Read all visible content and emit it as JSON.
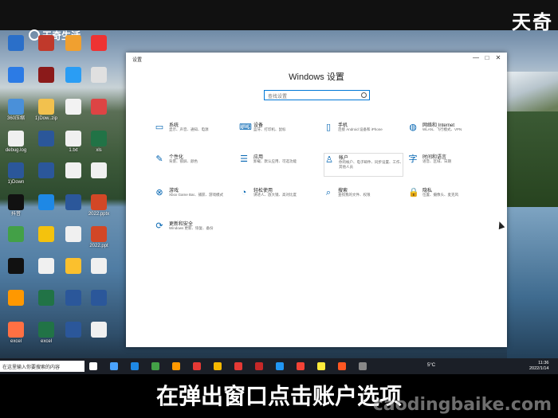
{
  "overlay": {
    "top_left_logo": "天奇生活",
    "top_right_brand": "天奇",
    "subtitle": "在弹出窗口点击账户选项",
    "watermark": "caodingbaike.com"
  },
  "desktop_icons": [
    {
      "label": "",
      "color": "#2a6fc9"
    },
    {
      "label": "",
      "color": "#c0392b"
    },
    {
      "label": "",
      "color": "#f0a030"
    },
    {
      "label": "",
      "color": "#e33"
    },
    {
      "label": "",
      "color": "#2c7be5"
    },
    {
      "label": "",
      "color": "#8b1a1a"
    },
    {
      "label": "",
      "color": "#2a9df4"
    },
    {
      "label": "",
      "color": "#e0e0e0"
    },
    {
      "label": "360压缩",
      "color": "#4a90d9"
    },
    {
      "label": "1)Dow..zip",
      "color": "#f2c14e"
    },
    {
      "label": "",
      "color": "#f2f2f2"
    },
    {
      "label": "",
      "color": "#d44"
    },
    {
      "label": "debug.log",
      "color": "#f0f0f0"
    },
    {
      "label": "",
      "color": "#2b579a"
    },
    {
      "label": "1.txt",
      "color": "#f0f0f0"
    },
    {
      "label": "xls",
      "color": "#217346"
    },
    {
      "label": "1)Down",
      "color": "#2b579a"
    },
    {
      "label": "",
      "color": "#2b579a"
    },
    {
      "label": "",
      "color": "#f0f0f0"
    },
    {
      "label": "",
      "color": "#f0f0f0"
    },
    {
      "label": "抖音",
      "color": "#111"
    },
    {
      "label": "",
      "color": "#1e88e5"
    },
    {
      "label": "",
      "color": "#2b579a"
    },
    {
      "label": "2022.pptx",
      "color": "#d24726"
    },
    {
      "label": "",
      "color": "#43a047"
    },
    {
      "label": "",
      "color": "#f4c20d"
    },
    {
      "label": "",
      "color": "#f0f0f0"
    },
    {
      "label": "2022.ppt",
      "color": "#d24726"
    },
    {
      "label": "",
      "color": "#111"
    },
    {
      "label": "",
      "color": "#f0f0f0"
    },
    {
      "label": "",
      "color": "#fbc02d"
    },
    {
      "label": "",
      "color": "#f0f0f0"
    },
    {
      "label": "",
      "color": "#ff9800"
    },
    {
      "label": "",
      "color": "#217346"
    },
    {
      "label": "",
      "color": "#2b579a"
    },
    {
      "label": "",
      "color": "#2b579a"
    },
    {
      "label": "excel",
      "color": "#ff7043"
    },
    {
      "label": "excel",
      "color": "#217346"
    },
    {
      "label": "",
      "color": "#2b579a"
    },
    {
      "label": "",
      "color": "#f0f0f0"
    }
  ],
  "window": {
    "title": "设置",
    "heading": "Windows 设置",
    "search_placeholder": "查找设置",
    "controls": [
      "—",
      "□",
      "✕"
    ],
    "tiles": [
      {
        "name": "系统",
        "desc": "显示、声音、通知、电源",
        "icon": "laptop-icon",
        "glyph": "▭",
        "highlight": false
      },
      {
        "name": "设备",
        "desc": "蓝牙、打印机、鼠标",
        "icon": "devices-icon",
        "glyph": "⌨",
        "highlight": false
      },
      {
        "name": "手机",
        "desc": "连接 Android 设备和 iPhone",
        "icon": "phone-icon",
        "glyph": "▯",
        "highlight": false
      },
      {
        "name": "网络和 Internet",
        "desc": "WLAN、飞行模式、VPN",
        "icon": "globe-icon",
        "glyph": "◍",
        "highlight": false
      },
      {
        "name": "个性化",
        "desc": "背景、锁屏、颜色",
        "icon": "personalization-icon",
        "glyph": "✎",
        "highlight": false
      },
      {
        "name": "应用",
        "desc": "卸载、默认应用、可选功能",
        "icon": "apps-icon",
        "glyph": "☰",
        "highlight": false
      },
      {
        "name": "帐户",
        "desc": "你的帐户、电子邮件、同步设置、工作、其他人员",
        "icon": "account-icon",
        "glyph": "♙",
        "highlight": true
      },
      {
        "name": "时间和语言",
        "desc": "语音、区域、日期",
        "icon": "time-language-icon",
        "glyph": "字",
        "highlight": false
      },
      {
        "name": "游戏",
        "desc": "Xbox Game Bar、捕获、游戏模式",
        "icon": "xbox-icon",
        "glyph": "⊗",
        "highlight": false
      },
      {
        "name": "轻松使用",
        "desc": "讲述人、放大镜、高对比度",
        "icon": "ease-of-access-icon",
        "glyph": "◔",
        "highlight": false
      },
      {
        "name": "搜索",
        "desc": "查找我的文件、权限",
        "icon": "search-icon",
        "glyph": "⌕",
        "highlight": false
      },
      {
        "name": "隐私",
        "desc": "位置、摄像头、麦克风",
        "icon": "lock-icon",
        "glyph": "🔒",
        "highlight": false
      },
      {
        "name": "更新和安全",
        "desc": "Windows 更新、恢复、备份",
        "icon": "update-icon",
        "glyph": "⟳",
        "highlight": false
      }
    ]
  },
  "taskbar": {
    "search_text": "在这里输入你要搜索的内容",
    "weather": "5°C",
    "time": "11:36",
    "date": "2022/1/14",
    "icons": [
      "#fff",
      "#4aa3ff",
      "#1e88e5",
      "#43a047",
      "#ff9800",
      "#e53935",
      "#f5b800",
      "#e53935",
      "#c62828",
      "#2196f3",
      "#f44336",
      "#ffeb3b",
      "#ff5722",
      "#888"
    ]
  }
}
